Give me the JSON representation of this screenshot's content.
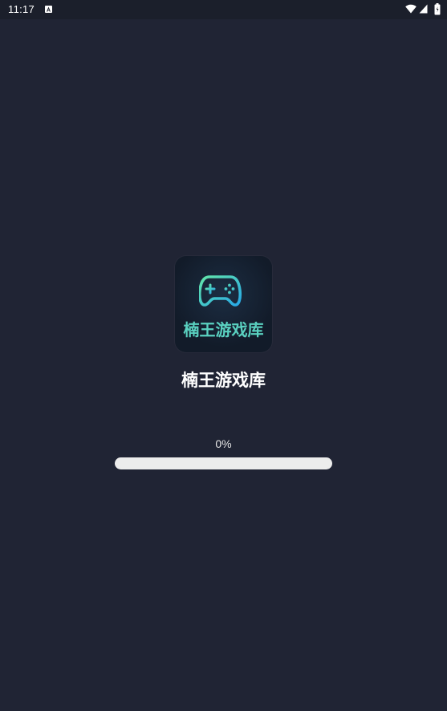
{
  "status_bar": {
    "time": "11:17"
  },
  "splash": {
    "icon_label": "楠王游戏库",
    "app_name": "楠王游戏库",
    "progress_text": "0%",
    "progress_value": 0
  },
  "colors": {
    "background": "#202434",
    "icon_text": "#5ad1c0",
    "progress_track": "#ececec"
  }
}
